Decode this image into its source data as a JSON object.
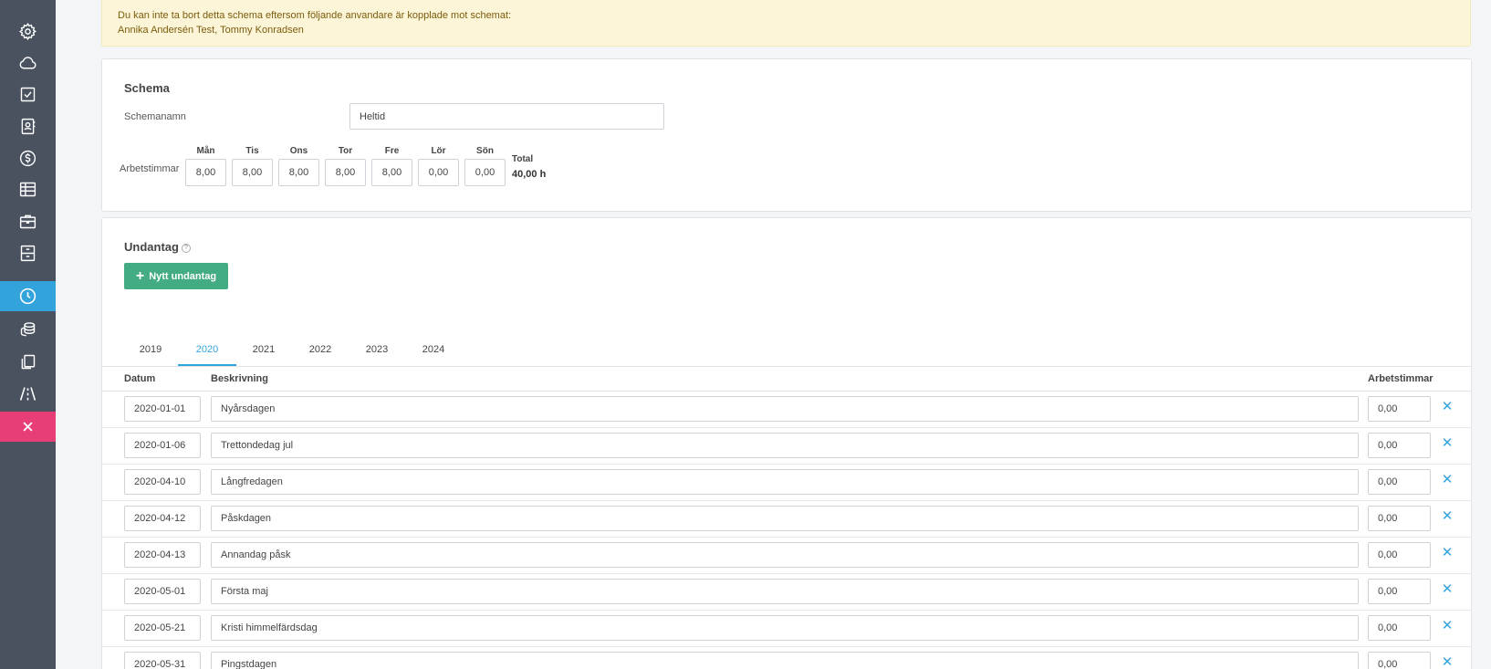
{
  "sidebar": {
    "items": [
      {
        "icon": "gear-icon"
      },
      {
        "icon": "cloud-icon"
      },
      {
        "icon": "checkbox-icon"
      },
      {
        "icon": "contacts-icon"
      },
      {
        "icon": "dollar-icon"
      },
      {
        "icon": "table-icon"
      },
      {
        "icon": "briefcase-icon"
      },
      {
        "icon": "archive-icon"
      },
      {
        "icon": "clock-icon",
        "active": true
      },
      {
        "icon": "coins-icon"
      },
      {
        "icon": "copy-icon"
      },
      {
        "icon": "road-icon"
      },
      {
        "icon": "close-icon",
        "danger": true
      }
    ],
    "colors": {
      "background": "#4a5260",
      "active": "#33a3dc",
      "danger": "#e83e78"
    }
  },
  "alert": {
    "line1": "Du kan inte ta bort detta schema eftersom följande anvandare är kopplade mot schemat:",
    "line2": "Annika Andersén Test, Tommy Konradsen"
  },
  "schema": {
    "title": "Schema",
    "name_label": "Schemanamn",
    "name_value": "Heltid",
    "hours_label": "Arbetstimmar",
    "days": [
      {
        "label": "Mån",
        "value": "8,00"
      },
      {
        "label": "Tis",
        "value": "8,00"
      },
      {
        "label": "Ons",
        "value": "8,00"
      },
      {
        "label": "Tor",
        "value": "8,00"
      },
      {
        "label": "Fre",
        "value": "8,00"
      },
      {
        "label": "Lör",
        "value": "0,00"
      },
      {
        "label": "Sön",
        "value": "0,00"
      }
    ],
    "total_label": "Total",
    "total_value": "40,00 h"
  },
  "exceptions": {
    "title": "Undantag",
    "help_icon": "?",
    "new_button": "Nytt undantag",
    "tabs": [
      "2019",
      "2020",
      "2021",
      "2022",
      "2023",
      "2024"
    ],
    "active_tab": "2020",
    "columns": {
      "date": "Datum",
      "description": "Beskrivning",
      "hours": "Arbetstimmar"
    },
    "rows": [
      {
        "date": "2020-01-01",
        "description": "Nyårsdagen",
        "hours": "0,00"
      },
      {
        "date": "2020-01-06",
        "description": "Trettondedag jul",
        "hours": "0,00"
      },
      {
        "date": "2020-04-10",
        "description": "Långfredagen",
        "hours": "0,00"
      },
      {
        "date": "2020-04-12",
        "description": "Påskdagen",
        "hours": "0,00"
      },
      {
        "date": "2020-04-13",
        "description": "Annandag påsk",
        "hours": "0,00"
      },
      {
        "date": "2020-05-01",
        "description": "Första maj",
        "hours": "0,00"
      },
      {
        "date": "2020-05-21",
        "description": "Kristi himmelfärdsdag",
        "hours": "0,00"
      },
      {
        "date": "2020-05-31",
        "description": "Pingstdagen",
        "hours": "0,00"
      }
    ],
    "delete_symbol": "✕",
    "accent": "#43ac82"
  }
}
